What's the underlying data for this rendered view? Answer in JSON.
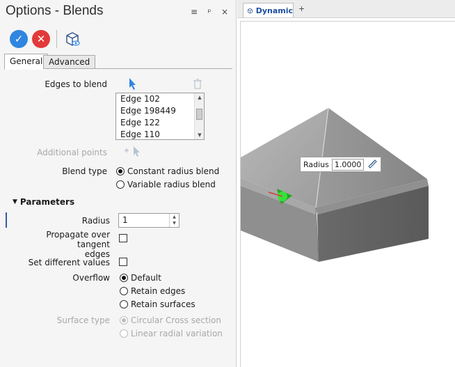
{
  "panel": {
    "title": "Options - Blends",
    "title_tools": {
      "menu": "≡",
      "pin": "ᵖ",
      "close": "×"
    },
    "toolbar": {
      "ok": "✓",
      "cancel": "✕"
    },
    "tabs": [
      {
        "label": "General"
      },
      {
        "label": "Advanced"
      }
    ],
    "edges_label": "Edges to blend",
    "edges": [
      "Edge 102",
      "Edge 198449",
      "Edge 122",
      "Edge 110"
    ],
    "additional_points_label": "Additional points",
    "blend_type_label": "Blend type",
    "blend_types": [
      {
        "label": "Constant radius blend",
        "selected": true
      },
      {
        "label": "Variable radius blend",
        "selected": false
      }
    ],
    "parameters_label": "Parameters",
    "radius_label": "Radius",
    "radius_value": "1",
    "propagate_label_1": "Propagate over tangent",
    "propagate_label_2": "edges",
    "set_different_label": "Set different values",
    "overflow_label": "Overflow",
    "overflow_options": [
      {
        "label": "Default",
        "selected": true
      },
      {
        "label": "Retain edges",
        "selected": false
      },
      {
        "label": "Retain surfaces",
        "selected": false
      }
    ],
    "surface_type_label": "Surface type",
    "surface_types": [
      {
        "label": "Circular Cross section",
        "selected": true
      },
      {
        "label": "Linear radial variation",
        "selected": false
      }
    ]
  },
  "viewport": {
    "tab_label": "Dynamic",
    "add_tab": "+",
    "radius_tip_label": "Radius",
    "radius_tip_value": "1.0000"
  },
  "colors": {
    "ok": "#2f86e0",
    "cancel": "#e23a3a",
    "accent": "#1c4fa0",
    "handle": "#22cc22"
  }
}
